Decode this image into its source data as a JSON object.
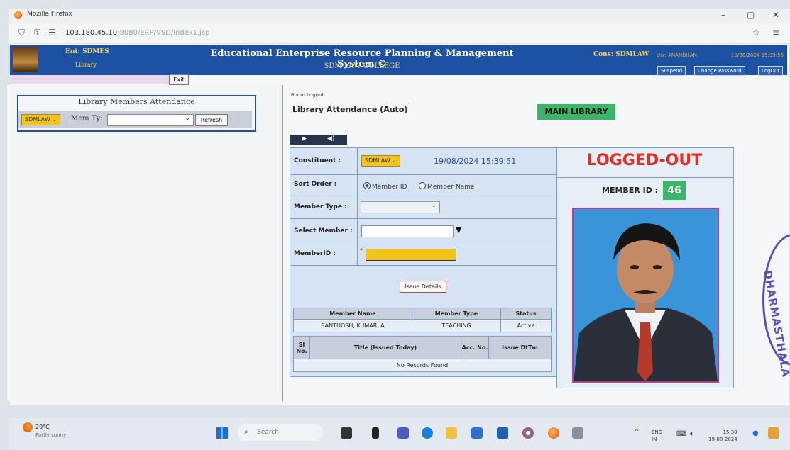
{
  "browser": {
    "title": "Mozilla Firefox",
    "url_host": "103.180.45.10",
    "url_rest": ":8080/ERP/VSD/index1.jsp"
  },
  "banner": {
    "entity": "Ent: SDMES",
    "module": "Library",
    "system_name": "Educational Enterprise Resource Planning & Management System ©",
    "college": "SDM LAW COLLEGE",
    "constituent": "Cons: SDMLAW",
    "user": "Usr: ANANDHAN",
    "datetime": "19/08/2024 15:39:56",
    "buttons": [
      "Suspend",
      "Change Password",
      "LogOut"
    ],
    "exit_label": "Exit"
  },
  "left": {
    "title": "Library Members Attendance",
    "constituent": "SDMLAW",
    "mem_type_label": "Mem Ty:",
    "refresh_label": "Refresh"
  },
  "right": {
    "room_logout": "Room Logout",
    "heading": "Library Attendance (Auto)",
    "location": "MAIN LIBRARY",
    "form": {
      "constituent_label": "Constituent :",
      "constituent_value": "SDMLAW",
      "clock": "19/08/2024 15:39:51",
      "sort_label": "Sort Order :",
      "sort_options": [
        "Member ID",
        "Member Name"
      ],
      "sort_selected": "Member ID",
      "member_type_label": "Member Type :",
      "select_member_label": "Select Member :",
      "member_id_label": "MemberID :",
      "member_id_value": "",
      "issue_button": "Issue Details"
    },
    "member_table": {
      "headers": [
        "Member Name",
        "Member Type",
        "Status"
      ],
      "row": [
        "SANTHOSH, KUMAR. A",
        "TEACHING",
        "Active"
      ]
    },
    "issue_table": {
      "headers": [
        "Sl No.",
        "Title (Issued Today)",
        "Acc. No.",
        "Issue DtTm"
      ],
      "empty_message": "No Records Found"
    },
    "profile": {
      "status": "LOGGED-OUT",
      "member_id_label": "MEMBER ID :",
      "member_id": "46"
    }
  },
  "stamp_text": "DHARMASTHALA",
  "taskbar": {
    "temperature": "29°C",
    "condition": "Partly sunny",
    "search_placeholder": "Search",
    "lang_top": "ENG",
    "lang_bottom": "IN",
    "time": "15:39",
    "date": "19-08-2024"
  },
  "colors": {
    "banner_blue": "#1d52a3",
    "highlight_yellow": "#f2c319",
    "status_red": "#e0302a",
    "location_green": "#3bb56a"
  }
}
